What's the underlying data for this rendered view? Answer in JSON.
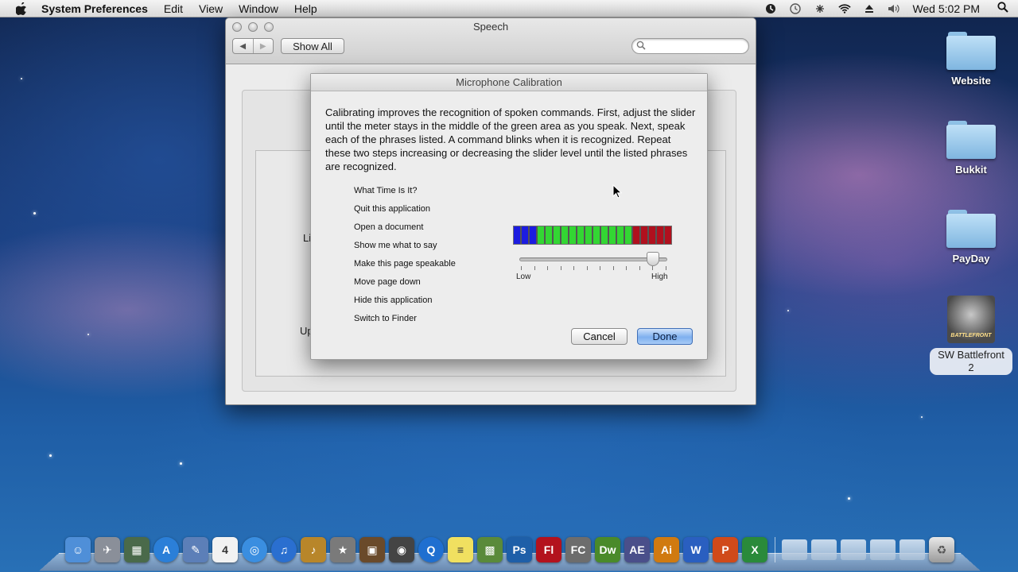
{
  "menubar": {
    "app_name": "System Preferences",
    "menus": [
      "Edit",
      "View",
      "Window",
      "Help"
    ],
    "clock": "Wed 5:02 PM",
    "status_icons": [
      "time-machine-icon",
      "clock-icon",
      "bluetooth-icon",
      "wifi-icon",
      "eject-icon",
      "volume-icon"
    ]
  },
  "desktop": {
    "icons": [
      {
        "label": "Website",
        "type": "folder"
      },
      {
        "label": "Bukkit",
        "type": "folder"
      },
      {
        "label": "PayDay",
        "type": "folder"
      },
      {
        "label": "SW Battlefront 2",
        "type": "game",
        "art_text": "BATTLEFRONT"
      }
    ]
  },
  "speech_window": {
    "title": "Speech",
    "show_all": "Show All",
    "search_placeholder": "",
    "background_labels": [
      "Li",
      "Up"
    ]
  },
  "calibration": {
    "title": "Microphone Calibration",
    "instructions": "Calibrating improves the recognition of spoken commands. First, adjust the slider until the meter stays in the middle of the green area as you speak. Next, speak each of the phrases listed. A command blinks when it is recognized. Repeat these two steps increasing or decreasing the slider level until the listed phrases are recognized.",
    "phrases": [
      "What Time Is It?",
      "Quit this application",
      "Open a document",
      "Show me what to say",
      "Make this page speakable",
      "Move page down",
      "Hide this application",
      "Switch to Finder"
    ],
    "meter": {
      "blue_segments": 3,
      "green_segments": 12,
      "red_segments": 5,
      "colors": {
        "blue": "#1c1ce0",
        "green": "#33d633",
        "red": "#b0101e"
      }
    },
    "slider": {
      "low_label": "Low",
      "high_label": "High",
      "level": 0.94,
      "tick_count": 12
    },
    "cancel": "Cancel",
    "done": "Done"
  },
  "dock": {
    "apps": [
      {
        "name": "finder-icon",
        "color": "#4f8fd8",
        "glyph": "☺"
      },
      {
        "name": "launchpad-icon",
        "color": "#8a8f99",
        "glyph": "✈"
      },
      {
        "name": "mission-control-icon",
        "color": "#4a6a4a",
        "glyph": "▦"
      },
      {
        "name": "app-store-icon",
        "color": "#2b7fd8",
        "glyph": "A"
      },
      {
        "name": "preview-icon",
        "color": "#5c7fb8",
        "glyph": "✎"
      },
      {
        "name": "calendar-icon",
        "color": "#f2f2f2",
        "glyph": "4"
      },
      {
        "name": "safari-icon",
        "color": "#3a8ee0",
        "glyph": "◎"
      },
      {
        "name": "itunes-icon",
        "color": "#2a6fd0",
        "glyph": "♫"
      },
      {
        "name": "garageband-icon",
        "color": "#b8862a",
        "glyph": "♪"
      },
      {
        "name": "imovie-icon",
        "color": "#7a7a7a",
        "glyph": "★"
      },
      {
        "name": "iphoto-icon",
        "color": "#6a4a2a",
        "glyph": "▣"
      },
      {
        "name": "photo-booth-icon",
        "color": "#444444",
        "glyph": "◉"
      },
      {
        "name": "quicktime-icon",
        "color": "#1f6fd0",
        "glyph": "Q"
      },
      {
        "name": "stickies-icon",
        "color": "#f0e060",
        "glyph": "≡"
      },
      {
        "name": "minecraft-icon",
        "color": "#5a8a3a",
        "glyph": "▩"
      },
      {
        "name": "photoshop-icon",
        "color": "#1e5fa8",
        "glyph": "Ps"
      },
      {
        "name": "flash-icon",
        "color": "#b3121d",
        "glyph": "Fl"
      },
      {
        "name": "fireworks-icon",
        "color": "#6d6d6d",
        "glyph": "FC"
      },
      {
        "name": "dreamweaver-icon",
        "color": "#4a8a2a",
        "glyph": "Dw"
      },
      {
        "name": "after-effects-icon",
        "color": "#4a4f8a",
        "glyph": "AE"
      },
      {
        "name": "illustrator-icon",
        "color": "#d07a10",
        "glyph": "Ai"
      },
      {
        "name": "word-icon",
        "color": "#2a5fc0",
        "glyph": "W"
      },
      {
        "name": "powerpoint-icon",
        "color": "#d04a1a",
        "glyph": "P"
      },
      {
        "name": "excel-icon",
        "color": "#2a8a3a",
        "glyph": "X"
      }
    ],
    "stacks": [
      "documents-stack-icon",
      "downloads-stack-icon",
      "pictures-stack-icon",
      "applications-stack-icon",
      "folder-stack-icon"
    ],
    "trash": "trash-icon"
  }
}
